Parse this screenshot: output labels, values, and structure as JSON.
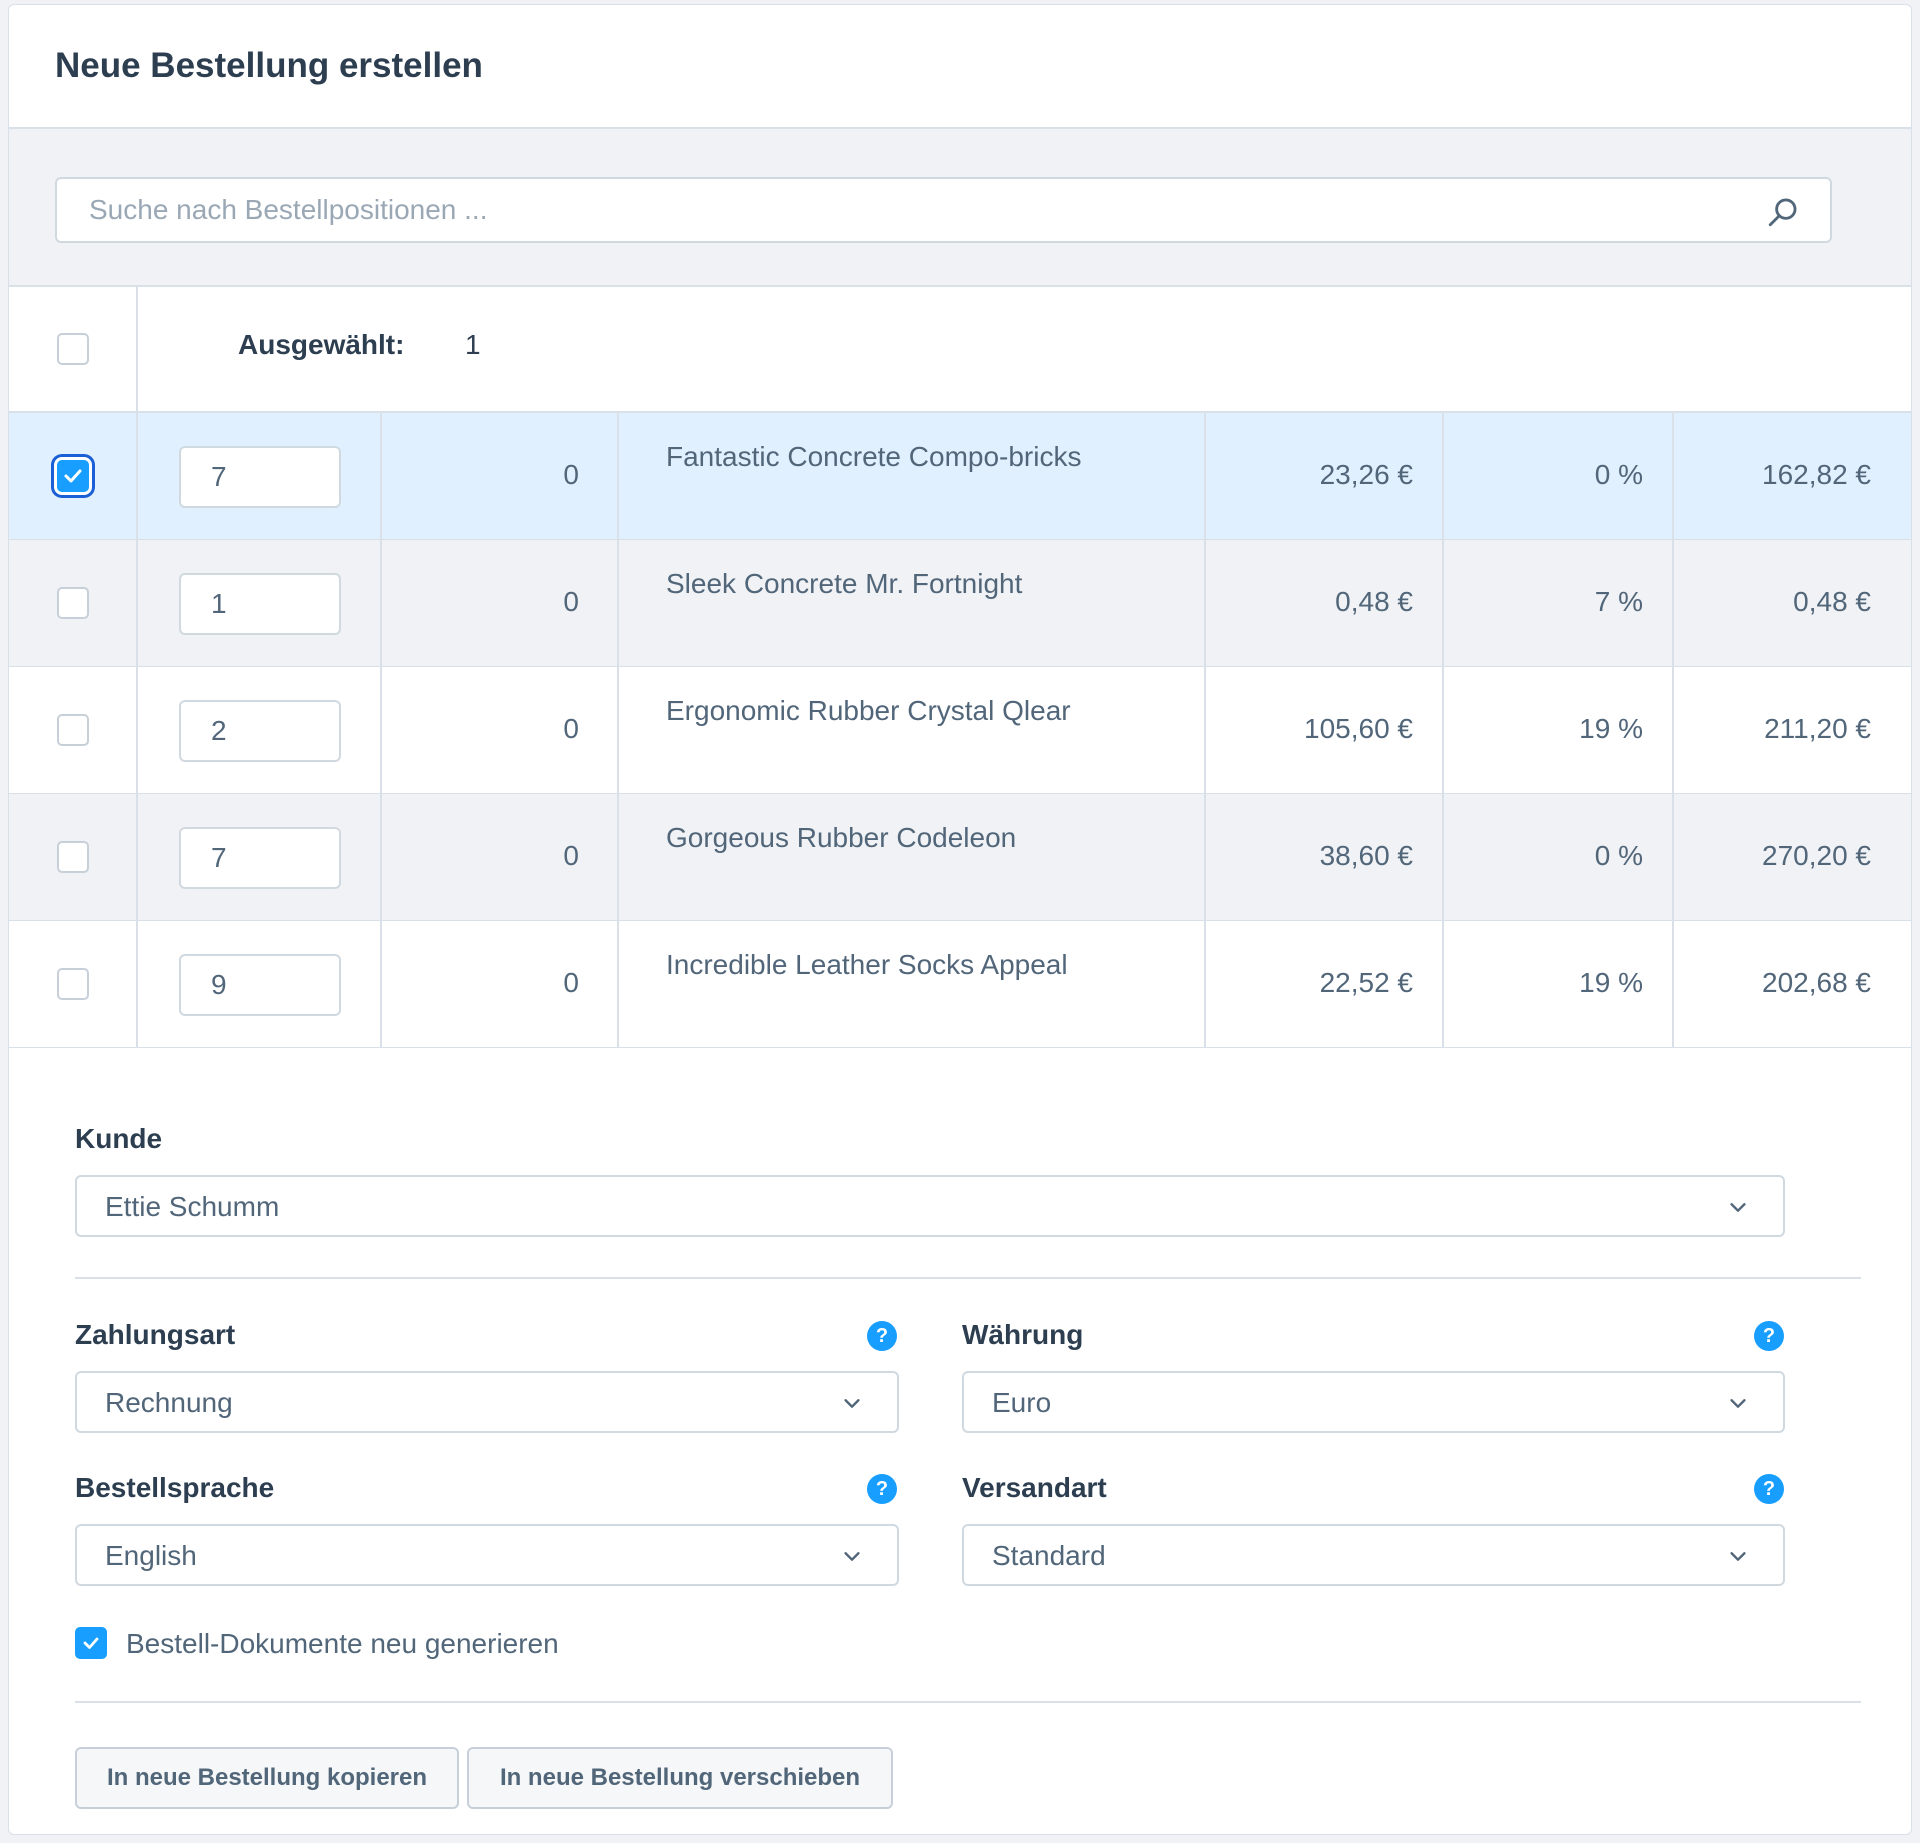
{
  "header": {
    "title": "Neue Bestellung erstellen"
  },
  "search": {
    "placeholder": "Suche nach Bestellpositionen ..."
  },
  "grid": {
    "selected_label": "Ausgewählt:",
    "selected_count": "1",
    "rows": [
      {
        "checked": true,
        "quantity": "7",
        "col2": "0",
        "product": "Fantastic Concrete Compo-bricks",
        "price": "23,26 €",
        "tax": "0 %",
        "total": "162,82 €"
      },
      {
        "checked": false,
        "quantity": "1",
        "col2": "0",
        "product": "Sleek Concrete Mr. Fortnight",
        "price": "0,48 €",
        "tax": "7 %",
        "total": "0,48 €"
      },
      {
        "checked": false,
        "quantity": "2",
        "col2": "0",
        "product": "Ergonomic Rubber Crystal Qlear",
        "price": "105,60 €",
        "tax": "19 %",
        "total": "211,20 €"
      },
      {
        "checked": false,
        "quantity": "7",
        "col2": "0",
        "product": "Gorgeous Rubber Codeleon",
        "price": "38,60 €",
        "tax": "0 %",
        "total": "270,20 €"
      },
      {
        "checked": false,
        "quantity": "9",
        "col2": "0",
        "product": "Incredible Leather Socks Appeal",
        "price": "22,52 €",
        "tax": "19 %",
        "total": "202,68 €"
      }
    ]
  },
  "form": {
    "customer": {
      "label": "Kunde",
      "value": "Ettie Schumm"
    },
    "payment": {
      "label": "Zahlungsart",
      "value": "Rechnung"
    },
    "currency": {
      "label": "Währung",
      "value": "Euro"
    },
    "language": {
      "label": "Bestellsprache",
      "value": "English"
    },
    "shipping": {
      "label": "Versandart",
      "value": "Standard"
    },
    "regenerate": {
      "label": "Bestell-Dokumente neu generieren",
      "checked": true
    },
    "help_glyph": "?"
  },
  "actions": {
    "copy_label": "In neue Bestellung kopieren",
    "move_label": "In neue Bestellung verschieben"
  },
  "colors": {
    "accent": "#189eff",
    "selected_row": "#e1f0ff",
    "focus_ring": "#1b5fd6"
  }
}
